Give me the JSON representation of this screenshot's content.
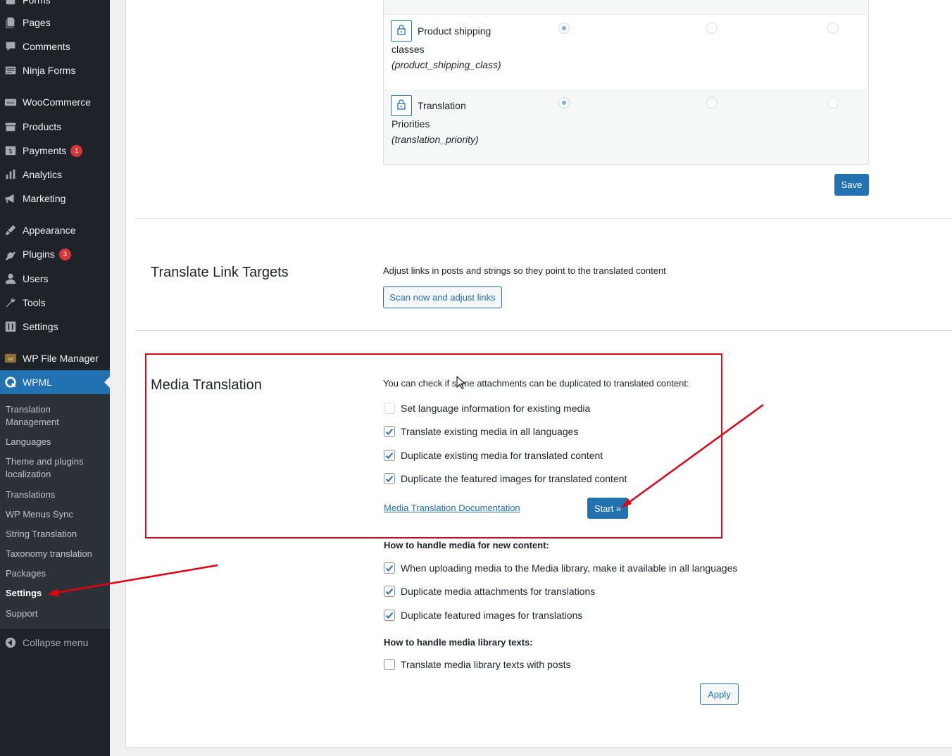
{
  "sidebar": {
    "items": [
      {
        "label": "Forms",
        "icon": "forms-icon"
      },
      {
        "label": "Pages",
        "icon": "pages-icon"
      },
      {
        "label": "Comments",
        "icon": "comments-icon"
      },
      {
        "label": "Ninja Forms",
        "icon": "ninja-forms-icon"
      },
      {
        "label": "WooCommerce",
        "icon": "woocommerce-icon"
      },
      {
        "label": "Products",
        "icon": "products-icon"
      },
      {
        "label": "Payments",
        "icon": "payments-icon",
        "badge": "1"
      },
      {
        "label": "Analytics",
        "icon": "analytics-icon"
      },
      {
        "label": "Marketing",
        "icon": "marketing-icon"
      },
      {
        "label": "Appearance",
        "icon": "appearance-icon"
      },
      {
        "label": "Plugins",
        "icon": "plugins-icon",
        "badge": "3"
      },
      {
        "label": "Users",
        "icon": "users-icon"
      },
      {
        "label": "Tools",
        "icon": "tools-icon"
      },
      {
        "label": "Settings",
        "icon": "settings-icon"
      },
      {
        "label": "WP File Manager",
        "icon": "file-manager-icon"
      },
      {
        "label": "WPML",
        "icon": "wpml-icon",
        "active": true
      }
    ],
    "submenu": [
      "Translation Management",
      "Languages",
      "Theme and plugins localization",
      "Translations",
      "WP Menus Sync",
      "String Translation",
      "Taxonomy translation",
      "Packages",
      "Settings",
      "Support"
    ],
    "submenu_current": "Settings",
    "collapse_label": "Collapse menu"
  },
  "taxonomy_table": {
    "rows": [
      {
        "line1": "Product shipping",
        "line2": "classes",
        "slug": "(product_shipping_class)",
        "selected_option": 1
      },
      {
        "line1": "Translation",
        "line2": "Priorities",
        "slug": "(translation_priority)",
        "selected_option": 1
      }
    ],
    "save_label": "Save"
  },
  "link_targets": {
    "title": "Translate Link Targets",
    "description": "Adjust links in posts and strings so they point to the translated content",
    "button_label": "Scan now and adjust links"
  },
  "media_translation": {
    "title": "Media Translation",
    "intro": "You can check if some attachments can be duplicated to translated content:",
    "existing_options": [
      {
        "label": "Set language information for existing media",
        "checked": false
      },
      {
        "label": "Translate existing media in all languages",
        "checked": true
      },
      {
        "label": "Duplicate existing media for translated content",
        "checked": true
      },
      {
        "label": "Duplicate the featured images for translated content",
        "checked": true
      }
    ],
    "doc_link": "Media Translation Documentation",
    "start_label": "Start »",
    "new_content_heading": "How to handle media for new content:",
    "new_content_options": [
      {
        "label": "When uploading media to the Media library, make it available in all languages",
        "checked": true
      },
      {
        "label": "Duplicate media attachments for translations",
        "checked": true
      },
      {
        "label": "Duplicate featured images for translations",
        "checked": true
      }
    ],
    "library_heading": "How to handle media library texts:",
    "library_options": [
      {
        "label": "Translate media library texts with posts",
        "checked": false
      }
    ],
    "apply_label": "Apply"
  },
  "colors": {
    "sidebar_bg": "#1d2327",
    "submenu_bg": "#2c3338",
    "accent": "#2271b1",
    "annotation_red": "#e60012"
  }
}
